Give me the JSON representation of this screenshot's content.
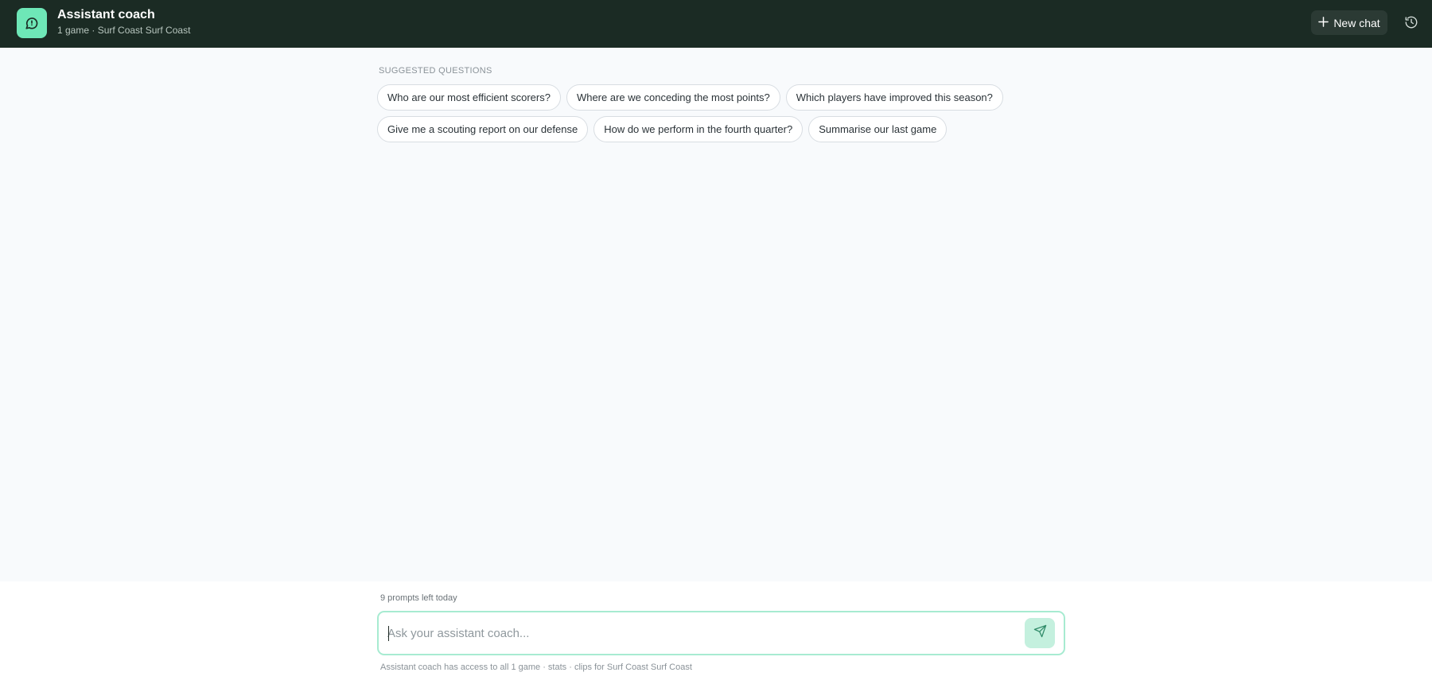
{
  "header": {
    "title": "Assistant coach",
    "subtitle": "1 game · Surf Coast Surf Coast",
    "logo_icon": "chat-bubble-icon",
    "new_chat_label": "New chat",
    "history_icon": "history-icon"
  },
  "suggestions": {
    "heading": "SUGGESTED QUESTIONS",
    "row1": [
      "Who are our most efficient scorers?",
      "Where are we conceding the most points?",
      "Which players have improved this season?"
    ],
    "row2": [
      "Give me a scouting report on our defense",
      "How do we perform in the fourth quarter?",
      "Summarise our last game"
    ]
  },
  "composer": {
    "prompts_left": "9 prompts left today",
    "placeholder": "Ask your assistant coach...",
    "value": "",
    "send_icon": "send-icon",
    "footnote": "Assistant coach has access to all 1 game · stats · clips for Surf Coast Surf Coast"
  },
  "colors": {
    "header_bg": "#1b2b24",
    "accent": "#6ee7b7",
    "input_border": "#a7ebd1",
    "send_bg": "#c4f0de"
  }
}
